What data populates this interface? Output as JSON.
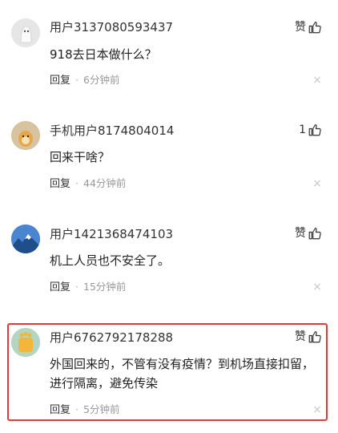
{
  "comments": [
    {
      "username": "用户3137080593437",
      "like_label": "赞",
      "text": "918去日本做什么？",
      "reply_label": "回复",
      "time": "6分钟前",
      "close": "×",
      "avatar": "ghost-avatar"
    },
    {
      "username": "手机用户8174804014",
      "like_label": "1",
      "text": "回来干啥？",
      "reply_label": "回复",
      "time": "44分钟前",
      "close": "×",
      "avatar": "cartoon-avatar"
    },
    {
      "username": "用户1421368474103",
      "like_label": "赞",
      "text": "机上人员也不安全了。",
      "reply_label": "回复",
      "time": "15分钟前",
      "close": "×",
      "avatar": "mountain-avatar"
    },
    {
      "username": "用户6762792178288",
      "like_label": "赞",
      "text": "外国回来的，不管有没有疫情？到机场直接扣留，进行隔离，避免传染",
      "reply_label": "回复",
      "time": "5分钟前",
      "close": "×",
      "avatar": "paw-avatar"
    }
  ],
  "colors": {
    "highlight_border": "#e03c3c",
    "meta_gray": "#999999"
  }
}
